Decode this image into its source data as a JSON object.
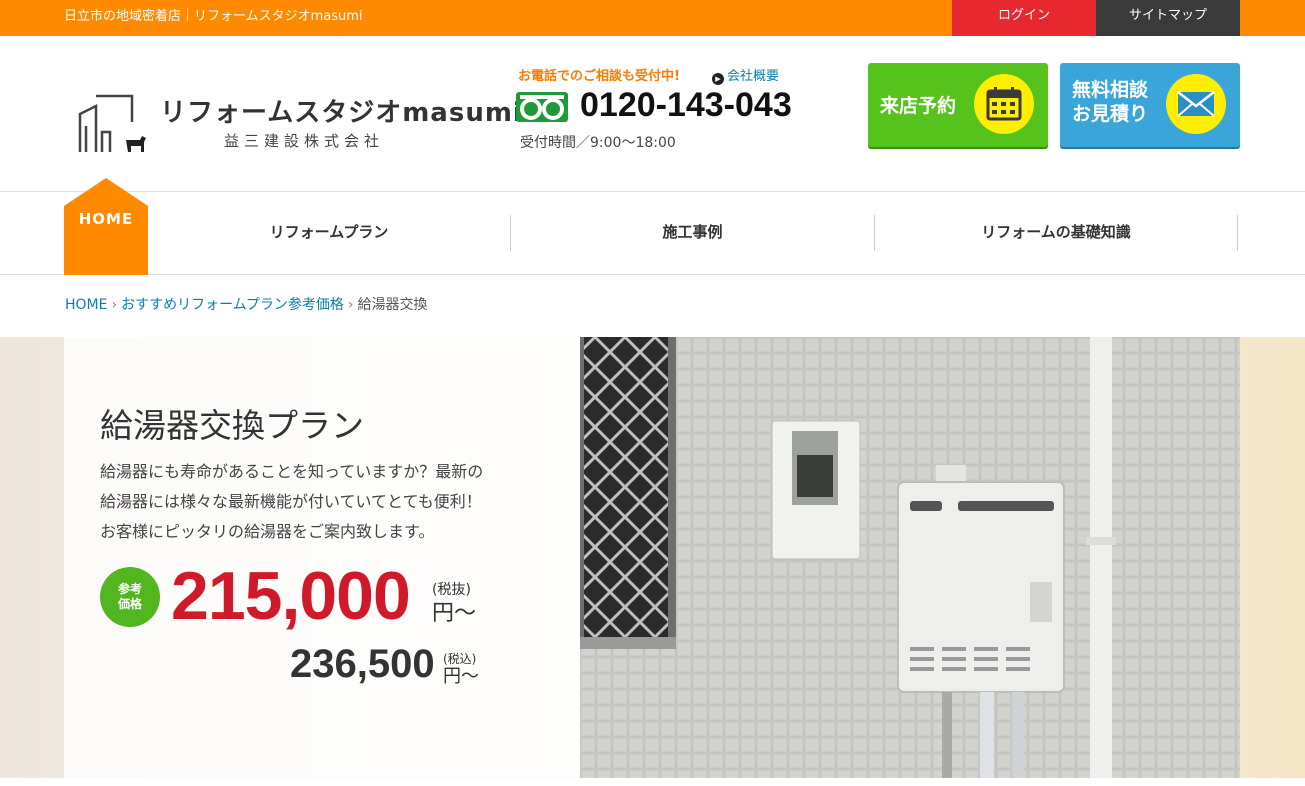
{
  "topbar": {
    "tagline": "日立市の地域密着店｜リフォームスタジオmasumi",
    "login_label": "ログイン",
    "sitemap_label": "サイトマップ",
    "bg_color": "#ff8a00"
  },
  "logo": {
    "name": "リフォームスタジオmasumi",
    "company": "益三建設株式会社"
  },
  "contact": {
    "consult_text": "お電話でのご相談も受付中!",
    "company_link": "会社概要",
    "phone": "0120-143-043",
    "hours": "受付時間／9:00〜18:00"
  },
  "cta": {
    "visit_label": "来店予約",
    "quote_line1": "無料相談",
    "quote_line2": "お見積り"
  },
  "nav": {
    "home": "HOME",
    "items": [
      "リフォームプラン",
      "施工事例",
      "リフォームの基礎知識"
    ]
  },
  "breadcrumb": {
    "home": "HOME",
    "parent": "おすすめリフォームプラン参考価格",
    "current": "給湯器交換"
  },
  "hero": {
    "title": "給湯器交換プラン",
    "desc_lines": [
      "給湯器にも寿命があることを知っていますか？最新の",
      "給湯器には様々な最新機能が付いていてとても便利！",
      "お客様にピッタリの給湯器をご案内致します。"
    ],
    "badge_line1": "参考",
    "badge_line2": "価格",
    "price_excl": "215,000",
    "tax_excl_label": "(税抜)",
    "yen_from": "円〜",
    "price_incl": "236,500",
    "tax_incl_label": "(税込)",
    "price_color": "#d01a2a"
  }
}
